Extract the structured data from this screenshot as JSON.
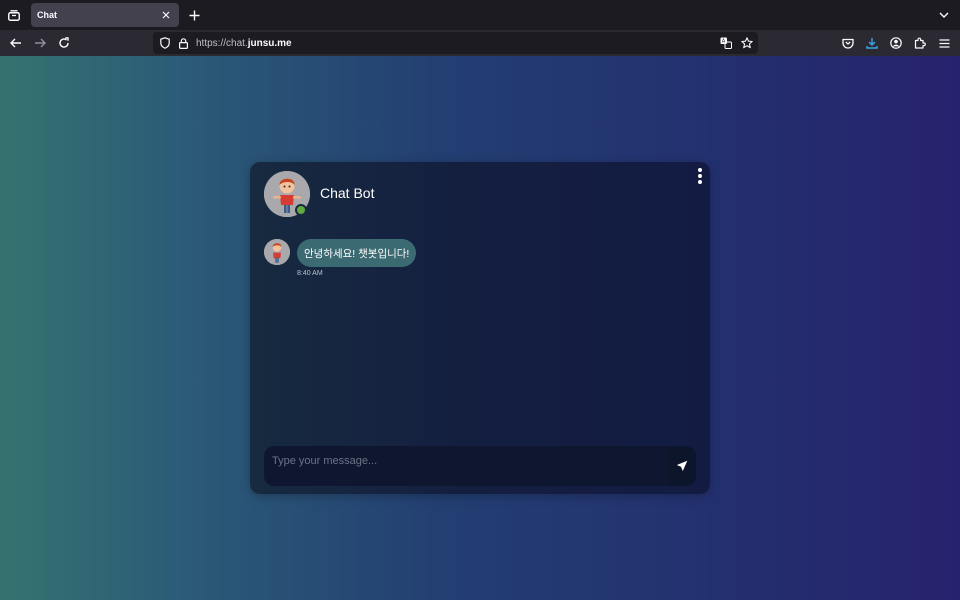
{
  "browser": {
    "tab": {
      "title": "Chat"
    },
    "url": {
      "scheme": "https://",
      "subdomain": "chat.",
      "domain": "junsu.me"
    }
  },
  "chat": {
    "bot_name": "Chat Bot",
    "status": "online",
    "messages": [
      {
        "sender": "bot",
        "text": "안녕하세요! 챗봇입니다!",
        "time": "8:40 AM"
      }
    ],
    "input": {
      "placeholder": "Type your message...",
      "value": ""
    }
  },
  "colors": {
    "bubble": "#3b6a73",
    "status_online": "#62a83d",
    "background_start": "#357370",
    "background_end": "#27226d"
  },
  "icons": {
    "tab_list": "tab-list-icon",
    "close": "close-icon",
    "new_tab": "plus-icon",
    "tabs_menu": "chevron-down-icon",
    "back": "back-arrow-icon",
    "forward": "forward-arrow-icon",
    "reload": "reload-icon",
    "shield": "shield-icon",
    "lock": "lock-icon",
    "translate": "translate-icon",
    "bookmark": "star-icon",
    "pocket": "pocket-icon",
    "downloads": "download-icon",
    "account": "account-icon",
    "extensions": "puzzle-icon",
    "menu": "hamburger-menu-icon",
    "more": "more-vertical-icon",
    "send": "send-icon"
  }
}
